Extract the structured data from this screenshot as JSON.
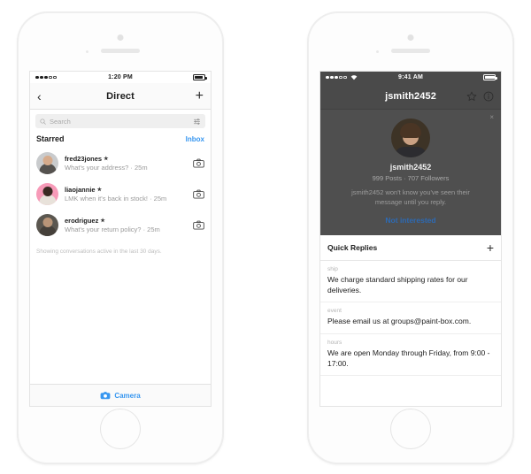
{
  "phones": {
    "left": {
      "status_bar": {
        "time": "1:20 PM",
        "signal": "signal-dots",
        "battery": "battery-icon"
      },
      "nav": {
        "back": "‹",
        "title": "Direct",
        "add": "+"
      },
      "search": {
        "placeholder": "Search",
        "icon": "search-icon",
        "filter_icon": "filter-sliders-icon"
      },
      "list_header": {
        "title": "Starred",
        "action": "Inbox"
      },
      "conversations": [
        {
          "name": "fred23jones",
          "starred": "★",
          "preview": "What's your address?",
          "time": "25m",
          "separator": "·",
          "avatar": "avatar-fred23jones",
          "action_icon": "camera-icon"
        },
        {
          "name": "liaojannie",
          "starred": "★",
          "preview": "LMK when it's back in stock!",
          "time": "25m",
          "separator": "·",
          "avatar": "avatar-liaojannie",
          "action_icon": "camera-icon"
        },
        {
          "name": "erodriguez",
          "starred": "★",
          "preview": "What's your return policy?",
          "time": "25m",
          "separator": "·",
          "avatar": "avatar-erodriguez",
          "action_icon": "camera-icon"
        }
      ],
      "note": "Showing conversations active in the last 30 days.",
      "tabbar": {
        "label": "Camera",
        "icon": "camera-icon"
      }
    },
    "right": {
      "status_bar": {
        "time": "9:41 AM",
        "signal": "signal-dots",
        "wifi": "wifi-icon",
        "battery": "battery-icon"
      },
      "nav": {
        "title": "jsmith2452",
        "star_icon": "star-outline-icon",
        "info_icon": "info-circle-icon"
      },
      "profile_overlay": {
        "close": "×",
        "avatar": "avatar-jsmith2452",
        "username": "jsmith2452",
        "stats": "999 Posts · 707 Followers",
        "message": "jsmith2452 won't know you've seen their message until you reply.",
        "action": "Not interested"
      },
      "quick_replies": {
        "title": "Quick Replies",
        "add": "+",
        "items": [
          {
            "shortcut": "ship",
            "text": "We charge standard shipping rates for our deliveries."
          },
          {
            "shortcut": "event",
            "text": "Please email us at groups@paint-box.com."
          },
          {
            "shortcut": "hours",
            "text": "We are open Monday through Friday, from 9:00 - 17:00."
          }
        ]
      }
    }
  },
  "colors": {
    "accent_blue": "#3897f0",
    "link_blue": "#2d6ab4",
    "overlay_dark": "#4f4f4f",
    "nav_dark": "#4a4a4a"
  }
}
